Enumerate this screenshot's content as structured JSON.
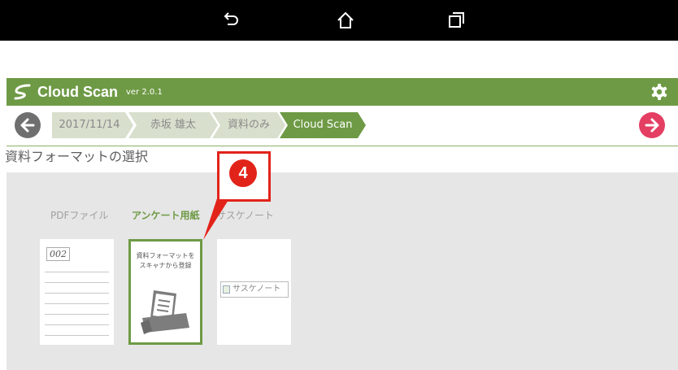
{
  "app": {
    "title": "Cloud Scan",
    "version": "ver 2.0.1"
  },
  "breadcrumbs": [
    "2017/11/14",
    "赤坂 雄太",
    "資料のみ",
    "Cloud Scan"
  ],
  "page": {
    "heading": "資料フォーマットの選択"
  },
  "tabs": [
    {
      "label": "PDFファイル",
      "active": false
    },
    {
      "label": "アンケート用紙",
      "active": true
    },
    {
      "label": "サスケノート",
      "active": false
    }
  ],
  "cards": {
    "pdf": {
      "code": "002"
    },
    "survey": {
      "line1": "資料フォーマットを",
      "line2": "スキャナから登録"
    },
    "note": {
      "alt": "サスケノート"
    }
  },
  "callout": {
    "number": "4"
  },
  "colors": {
    "accent": "#6e9a45",
    "next": "#e43e62",
    "callout": "#e2231a"
  },
  "icons": [
    "back-nav-icon",
    "home-nav-icon",
    "recents-nav-icon",
    "cloud-scan-logo",
    "gear-icon",
    "arrow-left-icon",
    "arrow-right-icon",
    "scanner-icon"
  ]
}
